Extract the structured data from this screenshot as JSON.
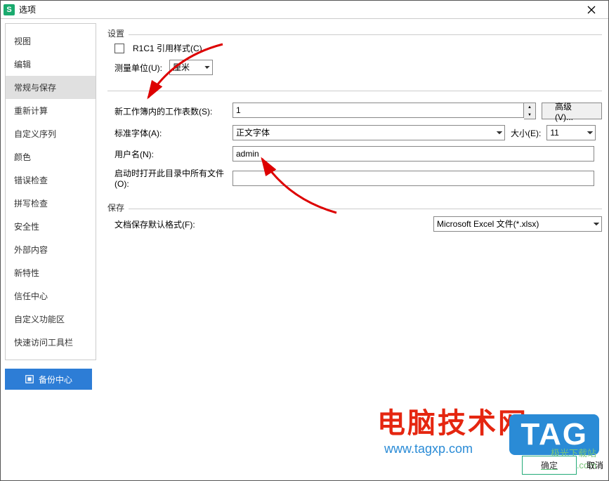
{
  "window": {
    "title": "选项"
  },
  "sidebar": {
    "items": [
      {
        "label": "视图"
      },
      {
        "label": "编辑"
      },
      {
        "label": "常规与保存"
      },
      {
        "label": "重新计算"
      },
      {
        "label": "自定义序列"
      },
      {
        "label": "颜色"
      },
      {
        "label": "错误检查"
      },
      {
        "label": "拼写检查"
      },
      {
        "label": "安全性"
      },
      {
        "label": "外部内容"
      },
      {
        "label": "新特性"
      },
      {
        "label": "信任中心"
      },
      {
        "label": "自定义功能区"
      },
      {
        "label": "快速访问工具栏"
      }
    ],
    "selected_index": 2,
    "backup_label": "备份中心"
  },
  "settings": {
    "section_label": "设置",
    "r1c1_label": "R1C1 引用样式(C)",
    "unit_label": "测量单位(U):",
    "unit_value": "厘米",
    "sheets_label": "新工作簿内的工作表数(S):",
    "sheets_value": "1",
    "advanced_label": "高级(V)...",
    "font_label": "标准字体(A):",
    "font_value": "正文字体",
    "size_label": "大小(E):",
    "size_value": "11",
    "username_label": "用户名(N):",
    "username_value": "admin",
    "startup_label": "启动时打开此目录中所有文件(O):",
    "startup_value": ""
  },
  "save": {
    "section_label": "保存",
    "default_format_label": "文档保存默认格式(F):",
    "default_format_value": "Microsoft Excel 文件(*.xlsx)"
  },
  "footer": {
    "ok": "确定",
    "cancel": "取消"
  },
  "watermarks": {
    "wm1": "电脑技术网",
    "wm1_sub": "www.tagxp.com",
    "tag": "TAG",
    "jg": "极光下载站",
    "jg_sub": "www.xz7.com"
  }
}
